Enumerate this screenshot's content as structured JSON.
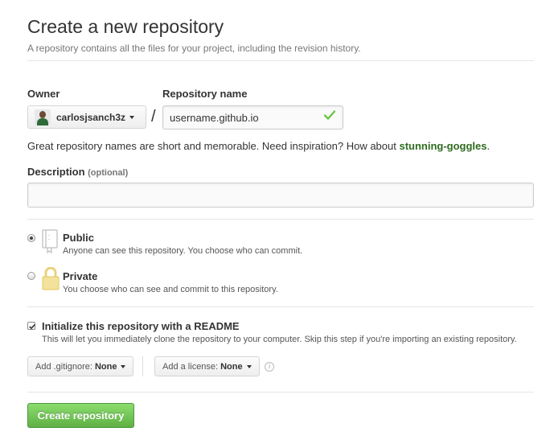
{
  "header": {
    "title": "Create a new repository",
    "subtitle": "A repository contains all the files for your project, including the revision history."
  },
  "owner": {
    "label": "Owner",
    "value": "carlosjsanch3z"
  },
  "repo_name": {
    "label": "Repository name",
    "value": "username.github.io",
    "valid": true
  },
  "separator": "/",
  "hint": {
    "text": "Great repository names are short and memorable. Need inspiration? How about ",
    "suggestion": "stunning-goggles",
    "end": "."
  },
  "description": {
    "label": "Description",
    "optional": "(optional)",
    "value": ""
  },
  "visibility": {
    "selected": "public",
    "public": {
      "title": "Public",
      "desc": "Anyone can see this repository. You choose who can commit."
    },
    "private": {
      "title": "Private",
      "desc": "You choose who can see and commit to this repository."
    }
  },
  "readme": {
    "checked": true,
    "title": "Initialize this repository with a README",
    "desc": "This will let you immediately clone the repository to your computer. Skip this step if you're importing an existing repository."
  },
  "gitignore": {
    "prefix": "Add .gitignore:",
    "value": "None"
  },
  "license": {
    "prefix": "Add a license:",
    "value": "None"
  },
  "info_icon": "i",
  "submit": {
    "label": "Create repository"
  },
  "colors": {
    "accent_green": "#60b044",
    "suggestion_green": "#2e6b1f",
    "check_green": "#6cc644"
  }
}
